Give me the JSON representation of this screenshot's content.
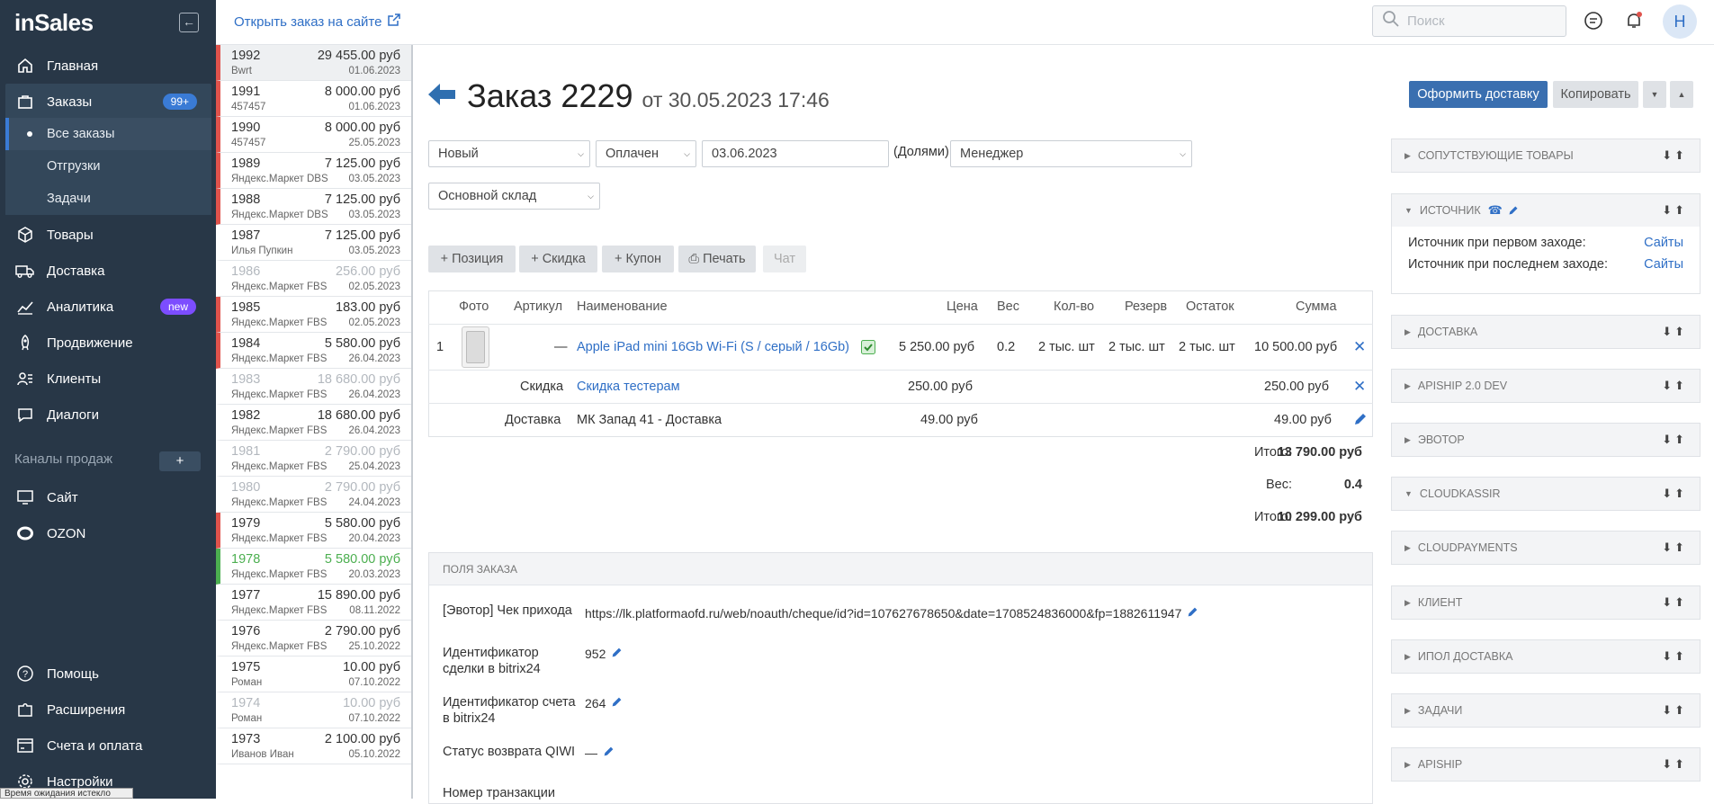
{
  "app": {
    "logo": "inSales",
    "colors": {
      "sidebar": "#283747",
      "accent": "#3a7bd5",
      "link": "#2f6fc6",
      "danger": "#e0534c",
      "success": "#4caf50",
      "new_badge": "#7c4dff"
    }
  },
  "sidebar": {
    "items": [
      {
        "label": "Главная",
        "icon": "home-icon"
      },
      {
        "label": "Заказы",
        "icon": "shopping-bag-icon",
        "badge": "99+"
      },
      {
        "label": "Товары",
        "icon": "box-icon"
      },
      {
        "label": "Доставка",
        "icon": "truck-icon"
      },
      {
        "label": "Аналитика",
        "icon": "chart-icon",
        "badge": "new"
      },
      {
        "label": "Продвижение",
        "icon": "rocket-icon"
      },
      {
        "label": "Клиенты",
        "icon": "users-icon"
      },
      {
        "label": "Диалоги",
        "icon": "chat-icon"
      }
    ],
    "sub_items": [
      "Все заказы",
      "Отгрузки",
      "Задачи"
    ],
    "channels_label": "Каналы продаж",
    "add_channel": "+",
    "channels": [
      {
        "label": "Сайт",
        "icon": "monitor-icon"
      },
      {
        "label": "OZON",
        "icon": "ozon-icon"
      }
    ],
    "bottom": [
      {
        "label": "Помощь",
        "icon": "help-icon"
      },
      {
        "label": "Расширения",
        "icon": "puzzle-icon"
      },
      {
        "label": "Счета и оплата",
        "icon": "billing-icon"
      },
      {
        "label": "Настройки",
        "icon": "gear-icon"
      }
    ],
    "status_tooltip": "Время ожидания истекло"
  },
  "topbar": {
    "open_link": "Открыть заказ на сайте",
    "search_placeholder": "Поиск",
    "avatar": "Н"
  },
  "orders": [
    {
      "num": "1992",
      "sum": "29 455.00 руб",
      "src": "Bwrt",
      "date": "01.06.2023",
      "state": "red sel"
    },
    {
      "num": "1991",
      "sum": "8 000.00 руб",
      "src": "457457",
      "date": "01.06.2023",
      "state": "red"
    },
    {
      "num": "1990",
      "sum": "8 000.00 руб",
      "src": "457457",
      "date": "25.05.2023",
      "state": "red"
    },
    {
      "num": "1989",
      "sum": "7 125.00 руб",
      "src": "Яндекс.Маркет DBS",
      "date": "03.05.2023",
      "state": "red"
    },
    {
      "num": "1988",
      "sum": "7 125.00 руб",
      "src": "Яндекс.Маркет DBS",
      "date": "03.05.2023",
      "state": "red"
    },
    {
      "num": "1987",
      "sum": "7 125.00 руб",
      "src": "Илья Пупкин",
      "date": "03.05.2023",
      "state": ""
    },
    {
      "num": "1986",
      "sum": "256.00 руб",
      "src": "Яндекс.Маркет FBS",
      "date": "02.05.2023",
      "state": "muted"
    },
    {
      "num": "1985",
      "sum": "183.00 руб",
      "src": "Яндекс.Маркет FBS",
      "date": "02.05.2023",
      "state": "red"
    },
    {
      "num": "1984",
      "sum": "5 580.00 руб",
      "src": "Яндекс.Маркет FBS",
      "date": "26.04.2023",
      "state": "red"
    },
    {
      "num": "1983",
      "sum": "18 680.00 руб",
      "src": "Яндекс.Маркет FBS",
      "date": "26.04.2023",
      "state": "muted"
    },
    {
      "num": "1982",
      "sum": "18 680.00 руб",
      "src": "Яндекс.Маркет FBS",
      "date": "26.04.2023",
      "state": ""
    },
    {
      "num": "1981",
      "sum": "2 790.00 руб",
      "src": "Яндекс.Маркет FBS",
      "date": "25.04.2023",
      "state": "muted"
    },
    {
      "num": "1980",
      "sum": "2 790.00 руб",
      "src": "Яндекс.Маркет FBS",
      "date": "24.04.2023",
      "state": "muted"
    },
    {
      "num": "1979",
      "sum": "5 580.00 руб",
      "src": "Яндекс.Маркет FBS",
      "date": "20.04.2023",
      "state": "red"
    },
    {
      "num": "1978",
      "sum": "5 580.00 руб",
      "src": "Яндекс.Маркет FBS",
      "date": "20.03.2023",
      "state": "green greentext"
    },
    {
      "num": "1977",
      "sum": "15 890.00 руб",
      "src": "Яндекс.Маркет FBS",
      "date": "08.11.2022",
      "state": ""
    },
    {
      "num": "1976",
      "sum": "2 790.00 руб",
      "src": "Яндекс.Маркет FBS",
      "date": "25.10.2022",
      "state": ""
    },
    {
      "num": "1975",
      "sum": "10.00 руб",
      "src": "Роман",
      "date": "07.10.2022",
      "state": ""
    },
    {
      "num": "1974",
      "sum": "10.00 руб",
      "src": "Роман",
      "date": "07.10.2022",
      "state": "muted"
    },
    {
      "num": "1973",
      "sum": "2 100.00 руб",
      "src": "Иванов Иван",
      "date": "05.10.2022",
      "state": ""
    }
  ],
  "order": {
    "title": "Заказ 2229",
    "subtitle": "от 30.05.2023 17:46",
    "btn_delivery": "Оформить доставку",
    "btn_copy": "Копировать",
    "status": "Новый",
    "payment": "Оплачен",
    "date": "03.06.2023",
    "dolyami": "(Долями)",
    "manager": "Менеджер",
    "warehouse": "Основной склад",
    "tools": {
      "position": "Позиция",
      "discount": "Скидка",
      "coupon": "Купон",
      "print": "Печать",
      "chat": "Чат"
    },
    "columns": {
      "photo": "Фото",
      "sku": "Артикул",
      "name": "Наименование",
      "price": "Цена",
      "weight": "Вес",
      "qty": "Кол-во",
      "reserve": "Резерв",
      "stock": "Остаток",
      "sum": "Сумма"
    },
    "item": {
      "index": "1",
      "sku": "—",
      "name": "Apple iPad mini 16Gb Wi-Fi (S / серый / 16Gb)",
      "price": "5 250.00 руб",
      "weight": "0.2",
      "qty": "2 тыс. шт",
      "reserve": "2 тыс. шт",
      "stock": "2 тыс. шт",
      "sum": "10 500.00 руб"
    },
    "discount_row": {
      "label": "Скидка",
      "name": "Скидка тестерам",
      "price": "250.00 руб",
      "sum": "250.00 руб"
    },
    "delivery_row": {
      "label": "Доставка",
      "name": "МК Запад 41 - Доставка",
      "price": "49.00 руб",
      "sum": "49.00 руб"
    },
    "totals": [
      {
        "label": "Итого:",
        "value": "13 790.00 руб"
      },
      {
        "label": "Вес:",
        "value": "0.4"
      },
      {
        "label": "Итого:",
        "value": "10 299.00 руб"
      }
    ],
    "fields_title": "ПОЛЯ ЗАКАЗА",
    "fields": [
      {
        "label": "[Эвотор] Чек прихода",
        "value": "https://lk.platformaofd.ru/web/noauth/cheque/id?id=107627678650&date=1708524836000&fp=1882611947"
      },
      {
        "label": "Идентификатор сделки в bitrix24",
        "value": "952"
      },
      {
        "label": "Идентификатор счета в bitrix24",
        "value": "264"
      },
      {
        "label": "Статус возврата QIWI",
        "value": "—"
      },
      {
        "label": "Номер транзакции",
        "value": ""
      }
    ]
  },
  "panels": [
    {
      "title": "СОПУТСТВУЮЩИЕ ТОВАРЫ",
      "open": false
    },
    {
      "title": "ИСТОЧНИК",
      "open": true
    },
    {
      "title": "ДОСТАВКА",
      "open": false
    },
    {
      "title": "APISHIP 2.0 DEV",
      "open": false
    },
    {
      "title": "ЭВОТОР",
      "open": false
    },
    {
      "title": "CLOUDKASSIR",
      "open": true
    },
    {
      "title": "CLOUDPAYMENTS",
      "open": false
    },
    {
      "title": "КЛИЕНТ",
      "open": false
    },
    {
      "title": "ИПОЛ ДОСТАВКА",
      "open": false
    },
    {
      "title": "ЗАДАЧИ",
      "open": false
    },
    {
      "title": "APISHIP",
      "open": false
    }
  ],
  "source": {
    "first_label": "Источник при первом заходе:",
    "first_value": "Сайты",
    "last_label": "Источник при последнем заходе:",
    "last_value": "Сайты"
  }
}
